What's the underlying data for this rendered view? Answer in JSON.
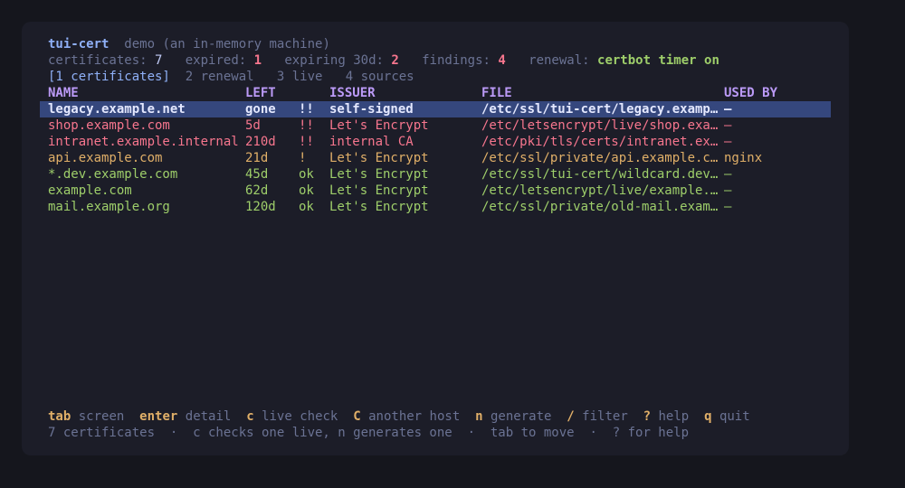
{
  "app": {
    "name": "tui-cert",
    "subtitle": "demo (an in-memory machine)"
  },
  "stats": {
    "certificates_label": "certificates:",
    "certificates_value": "7",
    "expired_label": "expired:",
    "expired_value": "1",
    "expiring_label": "expiring 30d:",
    "expiring_value": "2",
    "findings_label": "findings:",
    "findings_value": "4",
    "renewal_label": "renewal:",
    "renewal_value": "certbot timer on"
  },
  "tabs": [
    {
      "label": "[1 certificates]"
    },
    {
      "label": "2 renewal"
    },
    {
      "label": "3 live"
    },
    {
      "label": "4 sources"
    }
  ],
  "table": {
    "columns": [
      "NAME",
      "LEFT",
      "ISSUER",
      "FILE",
      "USED BY"
    ],
    "rows": [
      {
        "name": "legacy.example.net",
        "left": "gone",
        "flag": "!!",
        "issuer": "self-signed",
        "file": "/etc/ssl/tui-cert/legacy.examp…",
        "used_by": "—",
        "status": "selected"
      },
      {
        "name": "shop.example.com",
        "left": "5d",
        "flag": "!!",
        "issuer": "Let's Encrypt",
        "file": "/etc/letsencrypt/live/shop.exa…",
        "used_by": "—",
        "status": "expired"
      },
      {
        "name": "intranet.example.internal",
        "left": "210d",
        "flag": "!!",
        "issuer": "internal CA",
        "file": "/etc/pki/tls/certs/intranet.ex…",
        "used_by": "—",
        "status": "expired"
      },
      {
        "name": "api.example.com",
        "left": "21d",
        "flag": "!",
        "issuer": "Let's Encrypt",
        "file": "/etc/ssl/private/api.example.c…",
        "used_by": "nginx",
        "status": "warning"
      },
      {
        "name": "*.dev.example.com",
        "left": "45d",
        "flag": "ok",
        "issuer": "Let's Encrypt",
        "file": "/etc/ssl/tui-cert/wildcard.dev…",
        "used_by": "—",
        "status": "ok"
      },
      {
        "name": "example.com",
        "left": "62d",
        "flag": "ok",
        "issuer": "Let's Encrypt",
        "file": "/etc/letsencrypt/live/example.…",
        "used_by": "—",
        "status": "ok"
      },
      {
        "name": "mail.example.org",
        "left": "120d",
        "flag": "ok",
        "issuer": "Let's Encrypt",
        "file": "/etc/ssl/private/old-mail.exam…",
        "used_by": "—",
        "status": "ok"
      }
    ]
  },
  "keybar": [
    {
      "key": "tab",
      "desc": "screen"
    },
    {
      "key": "enter",
      "desc": "detail"
    },
    {
      "key": "c",
      "desc": "live check"
    },
    {
      "key": "C",
      "desc": "another host"
    },
    {
      "key": "n",
      "desc": "generate"
    },
    {
      "key": "/",
      "desc": "filter"
    },
    {
      "key": "?",
      "desc": "help"
    },
    {
      "key": "q",
      "desc": "quit"
    }
  ],
  "status_line": "7 certificates  ·  c checks one live, n generates one  ·  tab to move  ·  ? for help",
  "colors": {
    "background": "#15161d",
    "panel": "#1c1d28",
    "selected": "#35477d",
    "expired": "#f7768e",
    "warning": "#e0af68",
    "ok": "#9ece6a",
    "header": "#bb9af7",
    "accent": "#8fb0f7"
  }
}
